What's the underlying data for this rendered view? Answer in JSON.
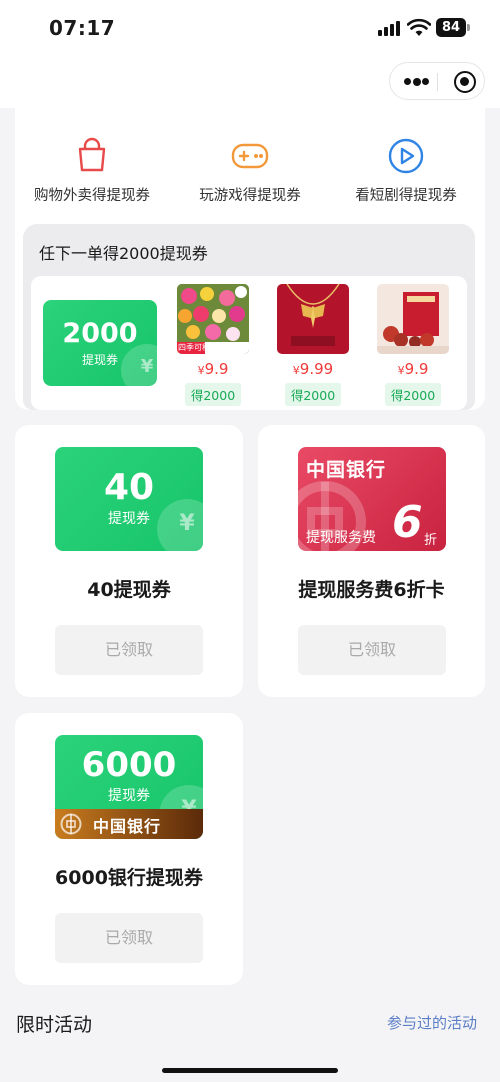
{
  "status_bar": {
    "time": "07:17",
    "battery": "84"
  },
  "categories": [
    {
      "label": "购物外卖得提现券",
      "icon": "shopping-bag-icon",
      "color": "#e84a4a"
    },
    {
      "label": "玩游戏得提现券",
      "icon": "gamepad-icon",
      "color": "#f29a3b"
    },
    {
      "label": "看短剧得提现券",
      "icon": "play-circle-icon",
      "color": "#2f84e6"
    }
  ],
  "promo": {
    "title": "任下一单得2000提现券",
    "coupon": {
      "amount": "2000",
      "label": "提现券"
    },
    "products": [
      {
        "price_symbol": "¥",
        "price": "9.9",
        "badge": "得2000",
        "caption": "四季可种 好养易活"
      },
      {
        "price_symbol": "¥",
        "price": "9.99",
        "badge": "得2000"
      },
      {
        "price_symbol": "¥",
        "price": "9.9",
        "badge": "得2000"
      }
    ]
  },
  "rewards": [
    {
      "coupon_amount": "40",
      "coupon_label": "提现券",
      "title": "40提现券",
      "button": "已领取"
    },
    {
      "bank": "中国银行",
      "service_label": "提现服务费",
      "discount_number": "6",
      "discount_unit": "折",
      "title": "提现服务费6折卡",
      "button": "已领取"
    },
    {
      "coupon_amount": "6000",
      "coupon_label": "提现券",
      "bank": "中国银行",
      "title": "6000银行提现券",
      "button": "已领取"
    }
  ],
  "footer": {
    "section_title": "限时活动",
    "link": "参与过的活动"
  },
  "colors": {
    "accent_green": "#1fc86f",
    "price_red": "#f03a3a",
    "link_blue": "#5b7ec7",
    "boc_red": "#d5304c"
  }
}
